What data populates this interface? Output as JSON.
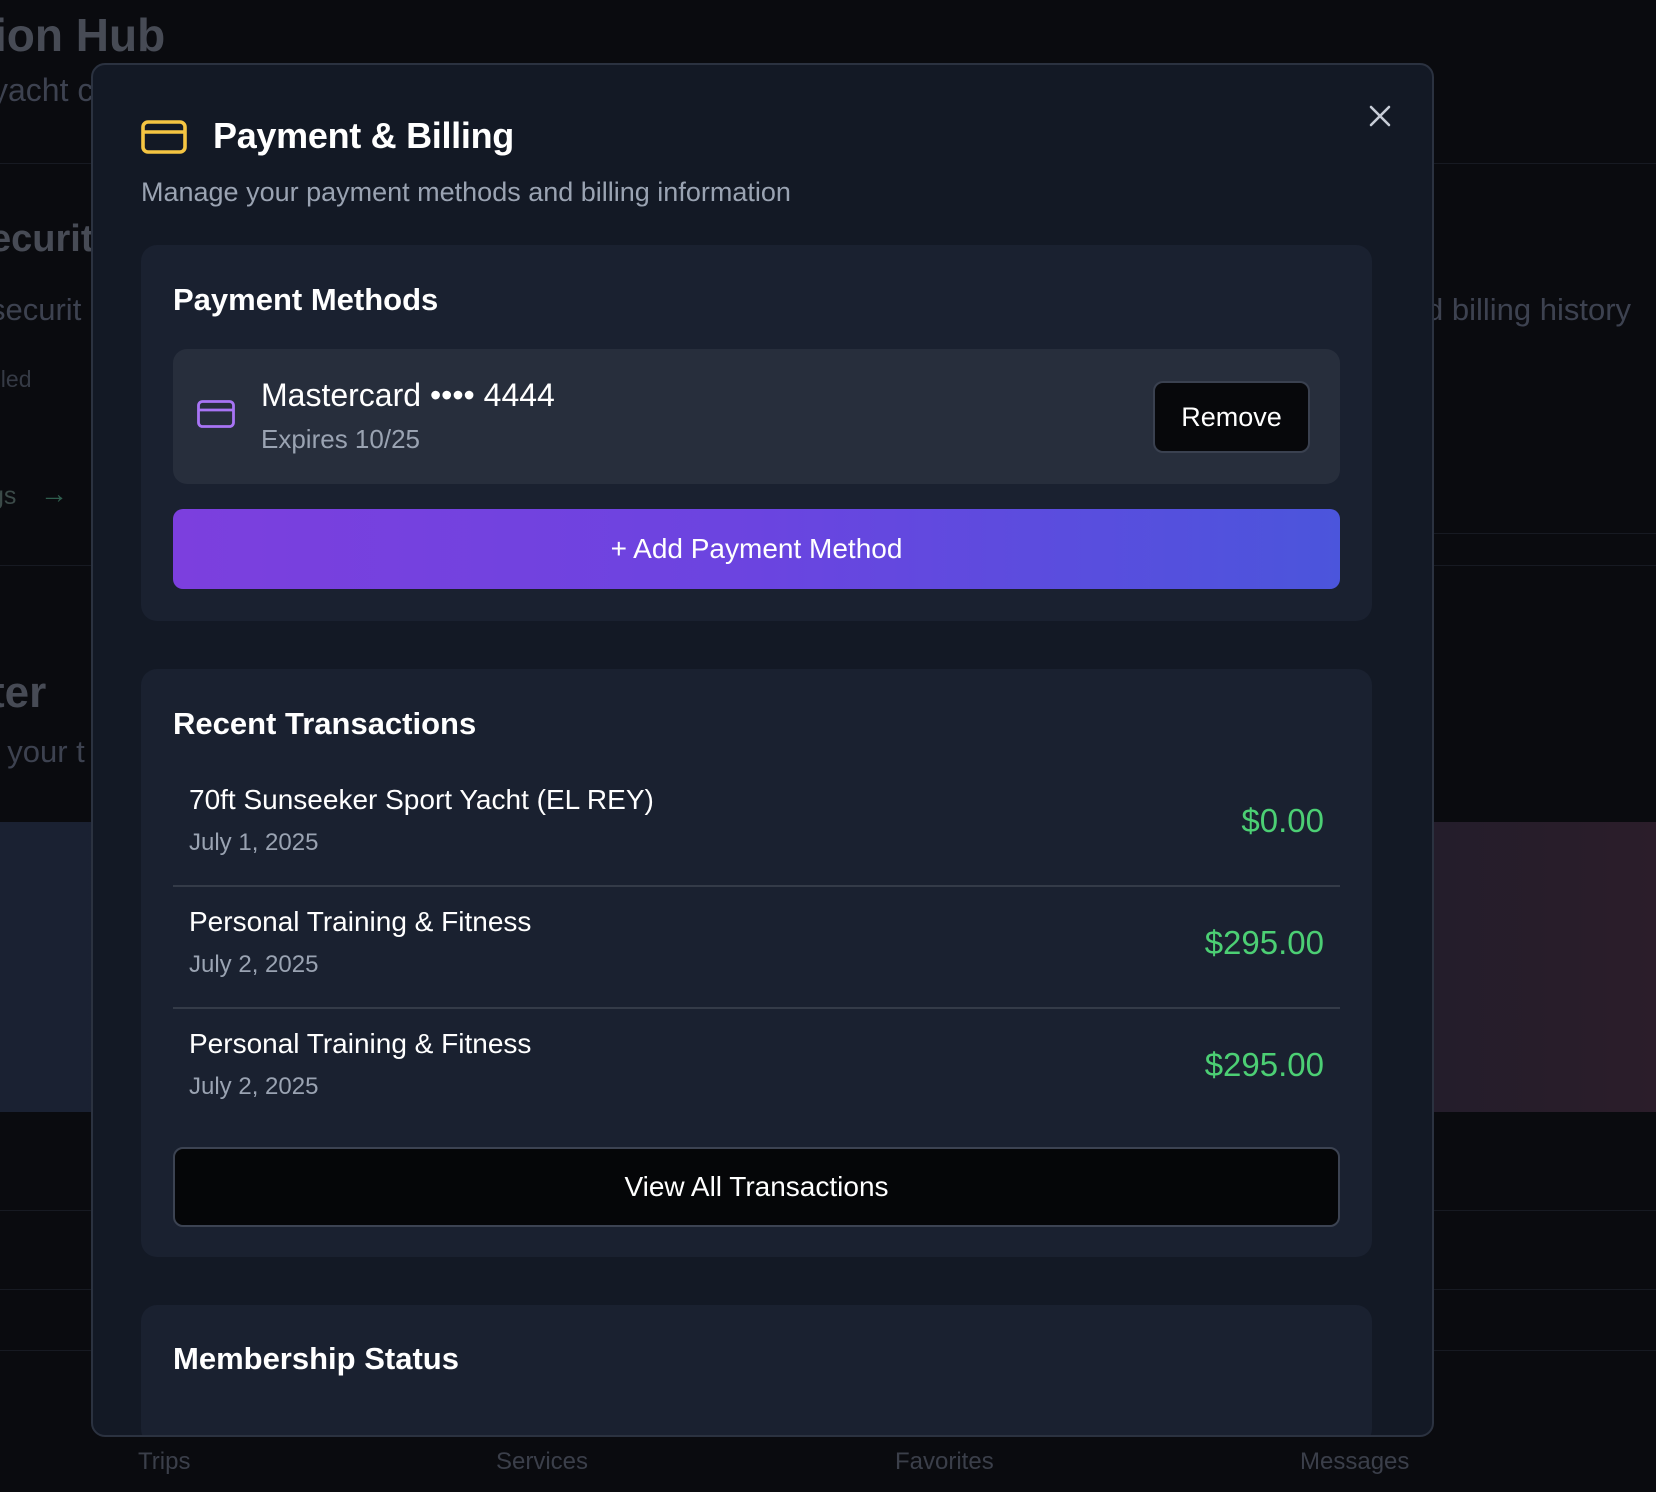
{
  "background": {
    "title_fragment": "ion Hub",
    "subtitle_fragment": "yacht c",
    "security_heading_fragment": "ecurit",
    "security_sub_fragment": "securit",
    "enabled_fragment": "bled",
    "link_fragment": "gs",
    "billing_history_fragment": "d billing history",
    "section_heading_fragment": "ter",
    "section_sub_fragment": "t your t",
    "bottom_nav": {
      "trips": "Trips",
      "services": "Services",
      "favorites": "Favorites",
      "messages": "Messages"
    }
  },
  "modal": {
    "title": "Payment & Billing",
    "subtitle": "Manage your payment methods and billing information",
    "icons": {
      "header": "credit-card-icon",
      "close": "close-icon",
      "card": "credit-card-icon"
    },
    "colors": {
      "header_icon": "#f5c542",
      "card_icon": "#a874f5",
      "amount": "#4ccf74",
      "add_button_start": "#7c3fde",
      "add_button_end": "#4b55dc"
    }
  },
  "payment_methods": {
    "heading": "Payment Methods",
    "cards": [
      {
        "name": "Mastercard •••• 4444",
        "expiry": "Expires 10/25",
        "remove_label": "Remove"
      }
    ],
    "add_label": "+ Add Payment Method"
  },
  "transactions": {
    "heading": "Recent Transactions",
    "items": [
      {
        "name": "70ft Sunseeker Sport Yacht (EL REY)",
        "date": "July 1, 2025",
        "amount": "$0.00"
      },
      {
        "name": "Personal Training & Fitness",
        "date": "July 2, 2025",
        "amount": "$295.00"
      },
      {
        "name": "Personal Training & Fitness",
        "date": "July 2, 2025",
        "amount": "$295.00"
      }
    ],
    "view_all_label": "View All Transactions"
  },
  "membership": {
    "heading": "Membership Status"
  }
}
